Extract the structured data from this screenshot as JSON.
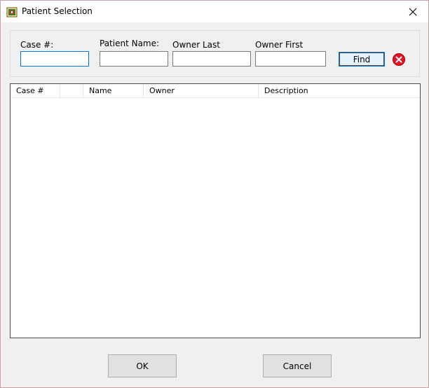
{
  "window": {
    "title": "Patient Selection",
    "icon": "app-icon",
    "close_glyph": "✕"
  },
  "search": {
    "case_label": "Case #:",
    "case_value": "",
    "patient_name_label": "Patient Name:",
    "patient_name_value": "",
    "owner_last_label": "Owner Last",
    "owner_last_value": "",
    "owner_first_label": "Owner First",
    "owner_first_value": "",
    "find_label": "Find",
    "clear_icon": "clear-icon"
  },
  "list": {
    "columns": [
      "Case #",
      "",
      "Name",
      "Owner",
      "Description"
    ],
    "rows": []
  },
  "footer": {
    "ok_label": "OK",
    "cancel_label": "Cancel"
  },
  "colors": {
    "focus": "#0078d7",
    "clear_red": "#e81123"
  }
}
